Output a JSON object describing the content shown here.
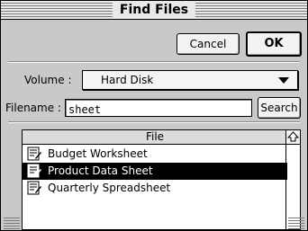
{
  "window": {
    "title": "Find Files"
  },
  "buttons": {
    "cancel": "Cancel",
    "ok": "OK",
    "search": "Search"
  },
  "volume": {
    "label": "Volume :",
    "value": "Hard Disk"
  },
  "filename": {
    "label": "Filename :",
    "value": "sheet"
  },
  "file_list": {
    "header": "File",
    "items": [
      {
        "name": "Budget Worksheet",
        "selected": false
      },
      {
        "name": "Product Data Sheet",
        "selected": true
      },
      {
        "name": "Quarterly Spreadsheet",
        "selected": false
      }
    ]
  },
  "icons": {
    "file": "spreadsheet-document-icon",
    "scroll_up": "scroll-up-arrow-icon",
    "dropdown": "triangle-down-icon"
  },
  "colors": {
    "window_bg": "#c9c9c9",
    "selection": "#000000",
    "selection_text": "#ffffff"
  }
}
